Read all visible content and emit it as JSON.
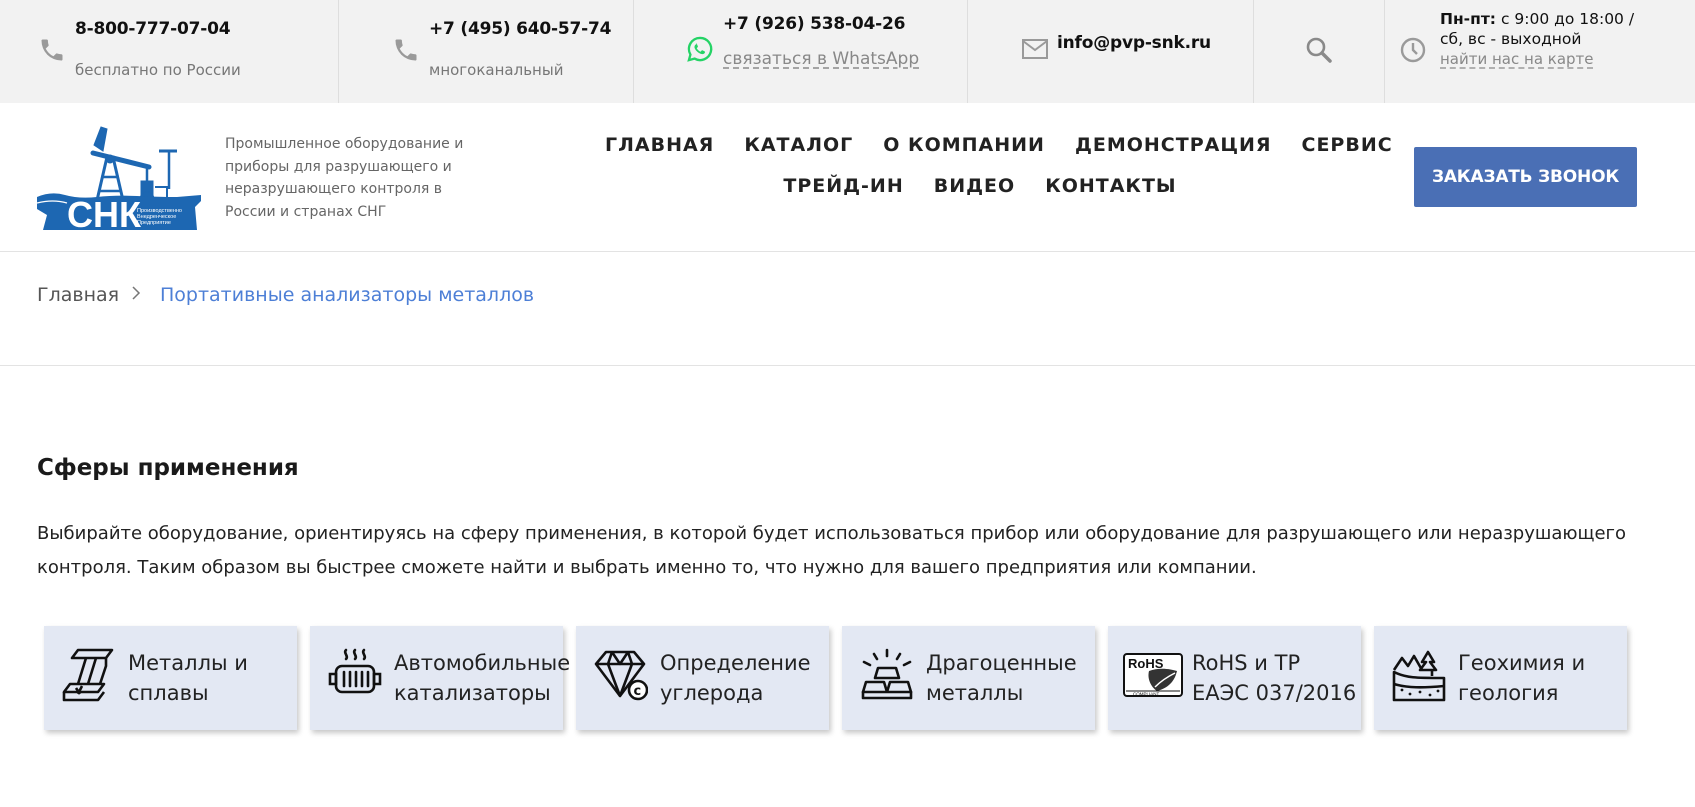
{
  "topbar": {
    "phone1": {
      "number": "8-800-777-07-04",
      "caption": "бесплатно по России",
      "icon": "phone-icon"
    },
    "phone2": {
      "number": "+7 (495) 640-57-74",
      "caption": "многоканальный",
      "icon": "phone-icon"
    },
    "whatsapp": {
      "number": "+7 (926) 538-04-26",
      "link": "связаться в WhatsApp",
      "icon": "whatsapp-icon",
      "color": "#25d366"
    },
    "email": {
      "address": "info@pvp-snk.ru",
      "icon": "mail-icon"
    },
    "search": {
      "icon": "search-icon"
    },
    "hours": {
      "weekdays_label": "Пн-пт:",
      "weekdays": " с 9:00 до 18:00 /",
      "weekend": "сб, вс - выходной",
      "map_link": "найти нас на карте",
      "icon": "clock-icon"
    }
  },
  "header": {
    "logo_text": "СНК",
    "logo_subtext": [
      "Производственно",
      "Внедренческое",
      "Предприятие"
    ],
    "tagline": "Промышленное оборудование и приборы для разрушающего и неразрушающего контроля в России и странах СНГ",
    "nav_row1": [
      "ГЛАВНАЯ",
      "КАТАЛОГ",
      "О КОМПАНИИ",
      "ДЕМОНСТРАЦИЯ",
      "СЕРВИС"
    ],
    "nav_row2": [
      "ТРЕЙД-ИН",
      "ВИДЕО",
      "КОНТАКТЫ"
    ],
    "cta": "ЗАКАЗАТЬ ЗВОНОК",
    "brand_color": "#4a6fb5"
  },
  "breadcrumb": {
    "home": "Главная",
    "separator": ">",
    "current": "Портативные анализаторы металлов"
  },
  "section": {
    "title": "Сферы применения",
    "description": "Выбирайте оборудование, ориентируясь на сферу применения, в которой будет использоваться прибор или оборудование для разрушающего или неразрушающего контроля. Таким образом вы быстрее сможете найти и выбрать именно то, что нужно для вашего предприятия или компании.",
    "cards": [
      {
        "label": "Металлы и\nсплавы",
        "icon": "steel-beam-icon"
      },
      {
        "label": "Автомобильные\nкатализаторы",
        "icon": "catalytic-converter-icon"
      },
      {
        "label": "Определение\nуглерода",
        "icon": "diamond-carbon-icon"
      },
      {
        "label": "Драгоценные\nметаллы",
        "icon": "gold-bars-icon"
      },
      {
        "label": "RoHS и ТР\nЕАЭС 037/2016",
        "icon": "rohs-compliant-icon",
        "icon_text": "RoHS",
        "icon_subtext": "COMPLIANT"
      },
      {
        "label": "Геохимия и\nгеология",
        "icon": "geology-icon"
      }
    ]
  }
}
